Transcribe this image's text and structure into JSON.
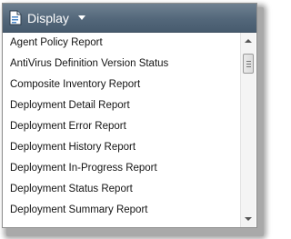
{
  "header": {
    "icon": "report-document-icon",
    "label": "Display"
  },
  "reports": [
    "Agent Policy Report",
    "AntiVirus Definition Version Status",
    "Composite Inventory Report",
    "Deployment Detail Report",
    "Deployment Error Report",
    "Deployment History Report",
    "Deployment In-Progress Report",
    "Deployment Status Report",
    "Deployment Summary Report"
  ],
  "colors": {
    "header_bg": "#53677a",
    "header_text": "#ffffff",
    "item_text": "#141414"
  }
}
